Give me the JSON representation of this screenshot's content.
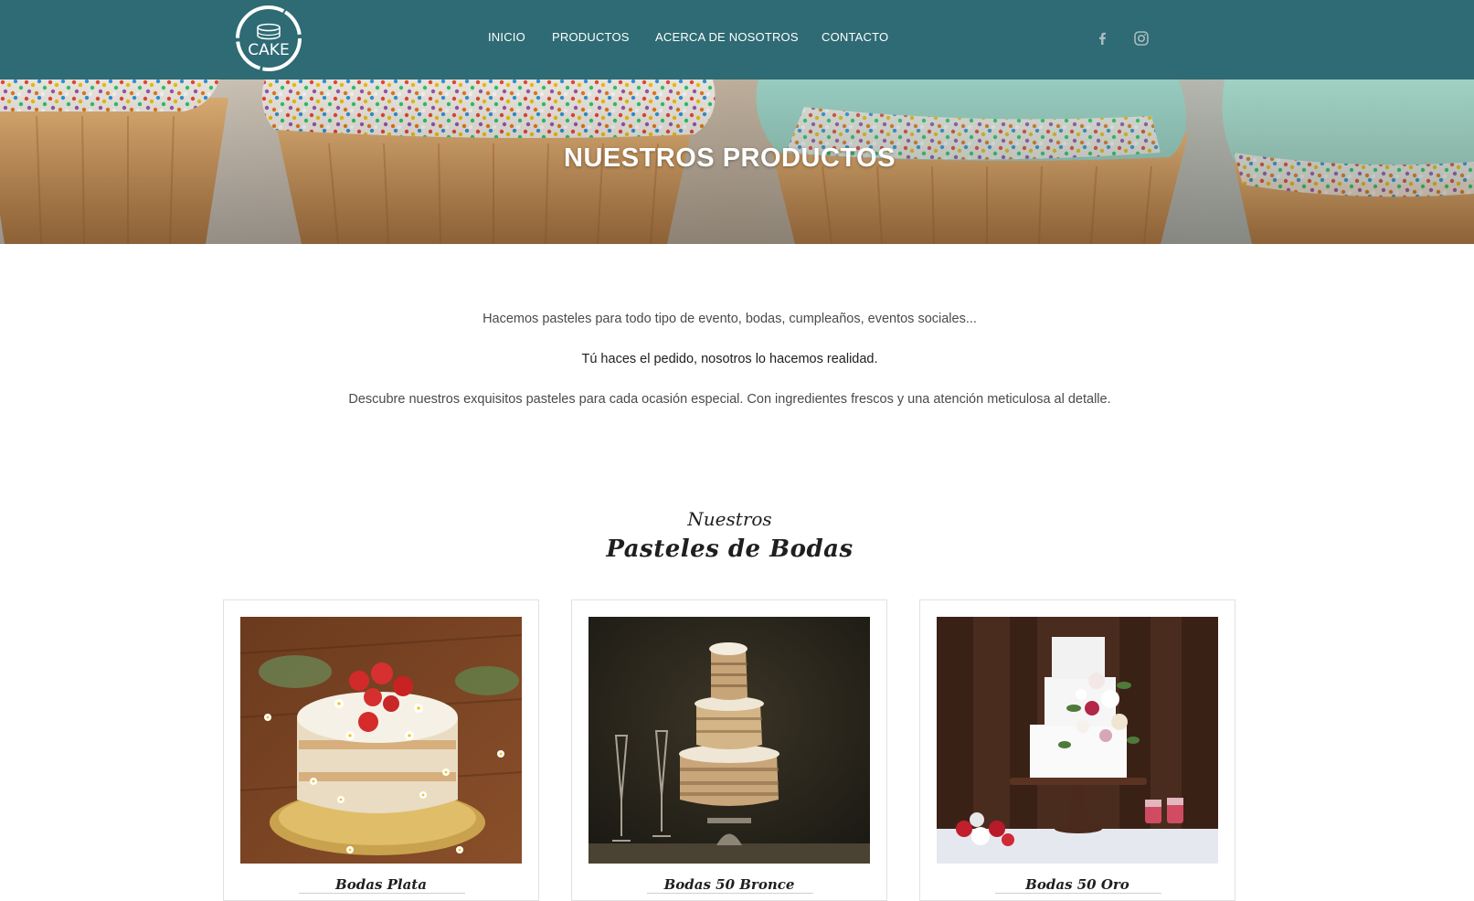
{
  "header": {
    "logo_text": "CAKE",
    "nav": [
      "INICIO",
      "PRODUCTOS",
      "ACERCA DE NOSOTROS",
      "CONTACTO"
    ],
    "social": [
      "facebook-icon",
      "instagram-icon"
    ],
    "colors": {
      "bar": "#2e6b74",
      "icons": "#a9bcbf"
    }
  },
  "banner": {
    "title": "NUESTROS PRODUCTOS"
  },
  "intro": {
    "line1": "Hacemos pasteles para todo tipo de evento, bodas, cumpleaños, eventos sociales...",
    "line2": "Tú haces el pedido, nosotros lo hacemos realidad.",
    "line3": "Descubre nuestros exquisitos pasteles para cada ocasión especial. Con ingredientes frescos y una atención meticulosa al detalle."
  },
  "section": {
    "kicker": "Nuestros",
    "title": "Pasteles de Bodas"
  },
  "products": [
    {
      "name": "Bodas Plata"
    },
    {
      "name": "Bodas 50 Bronce"
    },
    {
      "name": "Bodas 50 Oro"
    }
  ]
}
